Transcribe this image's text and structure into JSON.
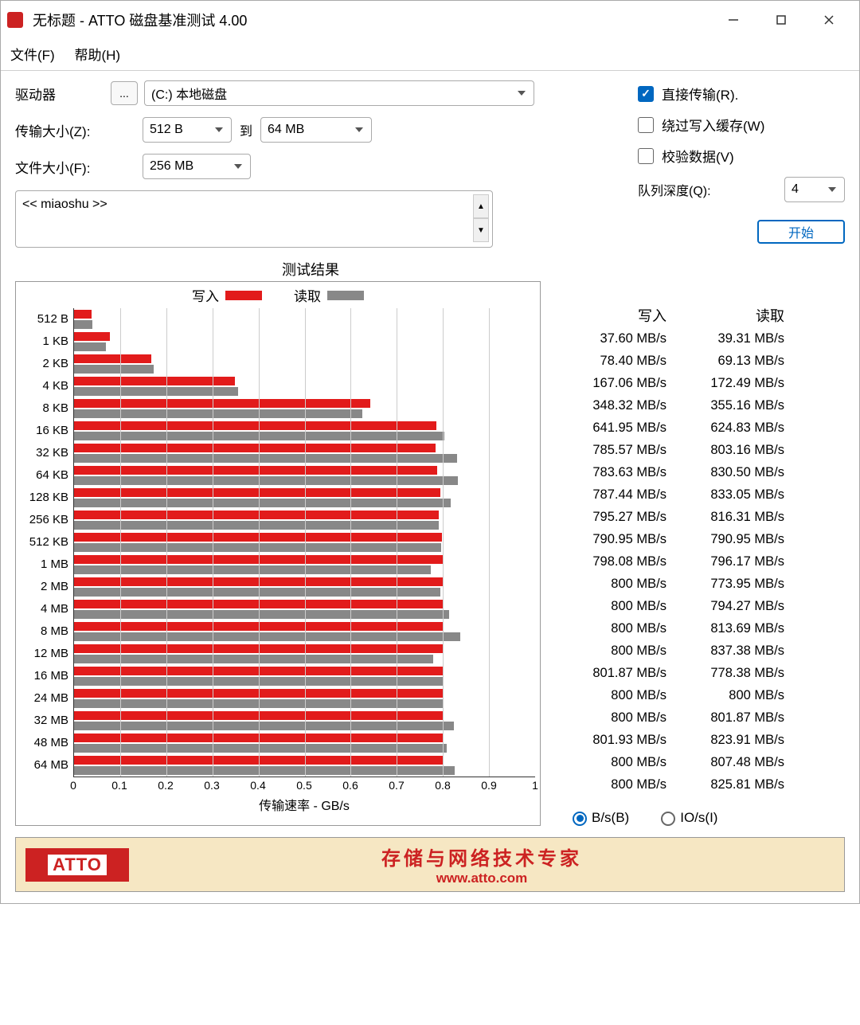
{
  "window": {
    "title": "无标题 - ATTO 磁盘基准测试 4.00"
  },
  "menu": {
    "file": "文件(F)",
    "help": "帮助(H)"
  },
  "form": {
    "drive_label": "驱动器",
    "drive_value": "(C:) 本地磁盘",
    "browse": "...",
    "transfer_label": "传输大小(Z):",
    "transfer_from": "512 B",
    "to_label": "到",
    "transfer_to": "64 MB",
    "file_label": "文件大小(F):",
    "file_value": "256 MB"
  },
  "options": {
    "direct": "直接传输(R).",
    "bypass": "绕过写入缓存(W)",
    "verify": "校验数据(V)",
    "qd_label": "队列深度(Q):",
    "qd_value": "4",
    "start": "开始"
  },
  "desc": "<< miaoshu >>",
  "results": {
    "title": "测试结果",
    "write_label": "写入",
    "read_label": "读取",
    "xaxis_label": "传输速率 - GB/s",
    "unit_bytes": "B/s(B)",
    "unit_io": "IO/s(I)"
  },
  "chart_data": {
    "type": "bar",
    "xlabel": "传输速率 - GB/s",
    "ylabel": "",
    "xlim": [
      0,
      1
    ],
    "xticks": [
      0,
      0.1,
      0.2,
      0.3,
      0.4,
      0.5,
      0.6,
      0.7,
      0.8,
      0.9,
      1
    ],
    "categories": [
      "512 B",
      "1 KB",
      "2 KB",
      "4 KB",
      "8 KB",
      "16 KB",
      "32 KB",
      "64 KB",
      "128 KB",
      "256 KB",
      "512 KB",
      "1 MB",
      "2 MB",
      "4 MB",
      "8 MB",
      "12 MB",
      "16 MB",
      "24 MB",
      "32 MB",
      "48 MB",
      "64 MB"
    ],
    "series": [
      {
        "name": "写入",
        "color": "#e21b1b",
        "unit": "MB/s",
        "values": [
          37.6,
          78.4,
          167.06,
          348.32,
          641.95,
          785.57,
          783.63,
          787.44,
          795.27,
          790.95,
          798.08,
          800,
          800,
          800,
          800,
          801.87,
          800,
          800,
          801.93,
          800,
          800
        ],
        "display": [
          "37.60 MB/s",
          "78.40 MB/s",
          "167.06 MB/s",
          "348.32 MB/s",
          "641.95 MB/s",
          "785.57 MB/s",
          "783.63 MB/s",
          "787.44 MB/s",
          "795.27 MB/s",
          "790.95 MB/s",
          "798.08 MB/s",
          "800 MB/s",
          "800 MB/s",
          "800 MB/s",
          "800 MB/s",
          "801.87 MB/s",
          "800 MB/s",
          "800 MB/s",
          "801.93 MB/s",
          "800 MB/s",
          "800 MB/s"
        ]
      },
      {
        "name": "读取",
        "color": "#888888",
        "unit": "MB/s",
        "values": [
          39.31,
          69.13,
          172.49,
          355.16,
          624.83,
          803.16,
          830.5,
          833.05,
          816.31,
          790.95,
          796.17,
          773.95,
          794.27,
          813.69,
          837.38,
          778.38,
          800,
          801.87,
          823.91,
          807.48,
          825.81
        ],
        "display": [
          "39.31 MB/s",
          "69.13 MB/s",
          "172.49 MB/s",
          "355.16 MB/s",
          "624.83 MB/s",
          "803.16 MB/s",
          "830.50 MB/s",
          "833.05 MB/s",
          "816.31 MB/s",
          "790.95 MB/s",
          "796.17 MB/s",
          "773.95 MB/s",
          "794.27 MB/s",
          "813.69 MB/s",
          "837.38 MB/s",
          "778.38 MB/s",
          "800 MB/s",
          "801.87 MB/s",
          "823.91 MB/s",
          "807.48 MB/s",
          "825.81 MB/s"
        ]
      }
    ]
  },
  "footer": {
    "logo": "ATTO",
    "line1": "存储与网络技术专家",
    "line2": "www.atto.com"
  }
}
